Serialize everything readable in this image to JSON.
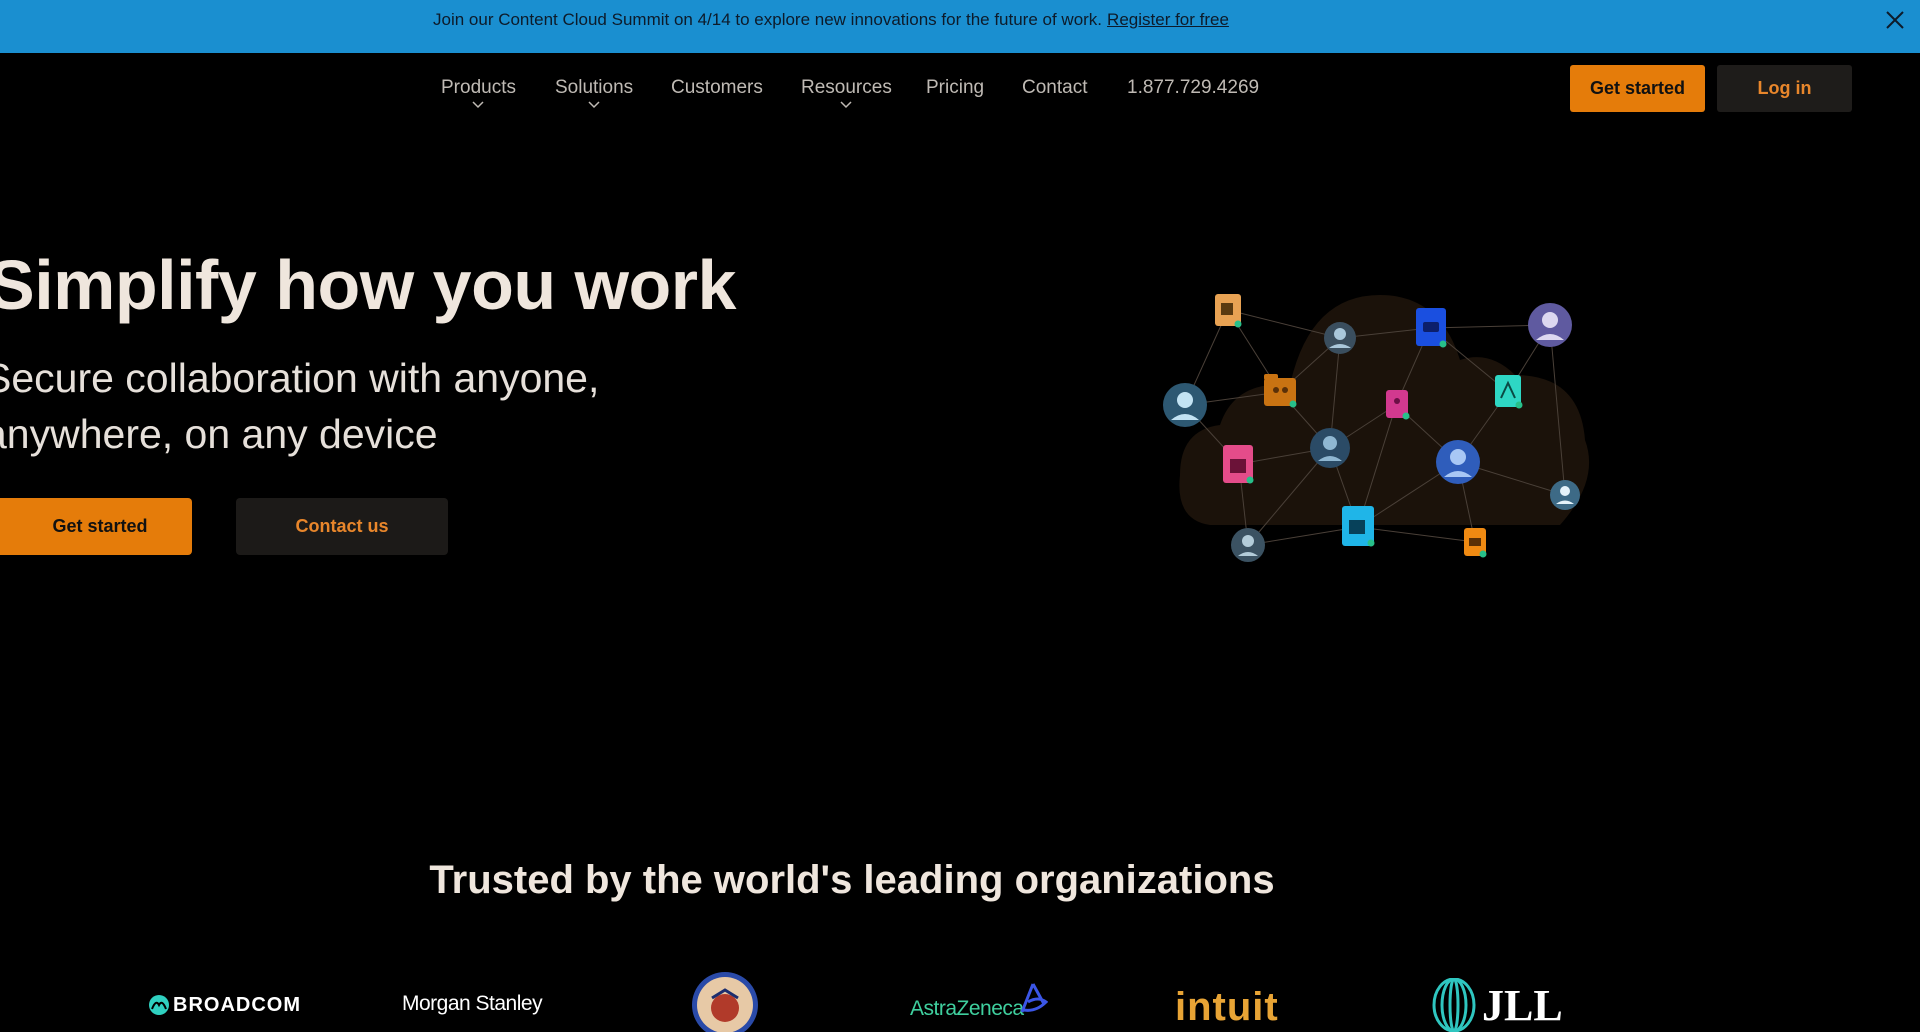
{
  "banner": {
    "text": "Join our Content Cloud Summit on 4/14 to explore new innovations for the future of work.",
    "link": "Register for free",
    "color": "#1a8fd0"
  },
  "nav": {
    "items": [
      {
        "label": "Products",
        "dropdown": true
      },
      {
        "label": "Solutions",
        "dropdown": true
      },
      {
        "label": "Customers",
        "dropdown": false
      },
      {
        "label": "Resources",
        "dropdown": true
      },
      {
        "label": "Pricing",
        "dropdown": false
      },
      {
        "label": "Contact",
        "dropdown": false
      },
      {
        "label": "1.877.729.4269",
        "dropdown": false
      }
    ],
    "get_started": "Get started",
    "login": "Log in"
  },
  "hero": {
    "title": "Simplify how you work",
    "subtitle_line1": "Secure collaboration with anyone,",
    "subtitle_line2": "anywhere, on any device",
    "cta_primary": "Get started",
    "cta_secondary": "Contact us"
  },
  "trusted": {
    "heading": "Trusted by the world's leading organizations",
    "logos": [
      {
        "name": "broadcom-logo",
        "text": "BROADCOM"
      },
      {
        "name": "morgan-stanley-logo",
        "text": "Morgan Stanley"
      },
      {
        "name": "us-air-force-seal-logo",
        "text": ""
      },
      {
        "name": "astrazeneca-logo",
        "text": "AstraZeneca"
      },
      {
        "name": "intuit-logo",
        "text": "intuit"
      },
      {
        "name": "jll-logo",
        "text": "JLL"
      }
    ]
  },
  "colors": {
    "accent_orange": "#e57c0a",
    "background": "#000000",
    "secondary_button": "#1e1c1a"
  }
}
